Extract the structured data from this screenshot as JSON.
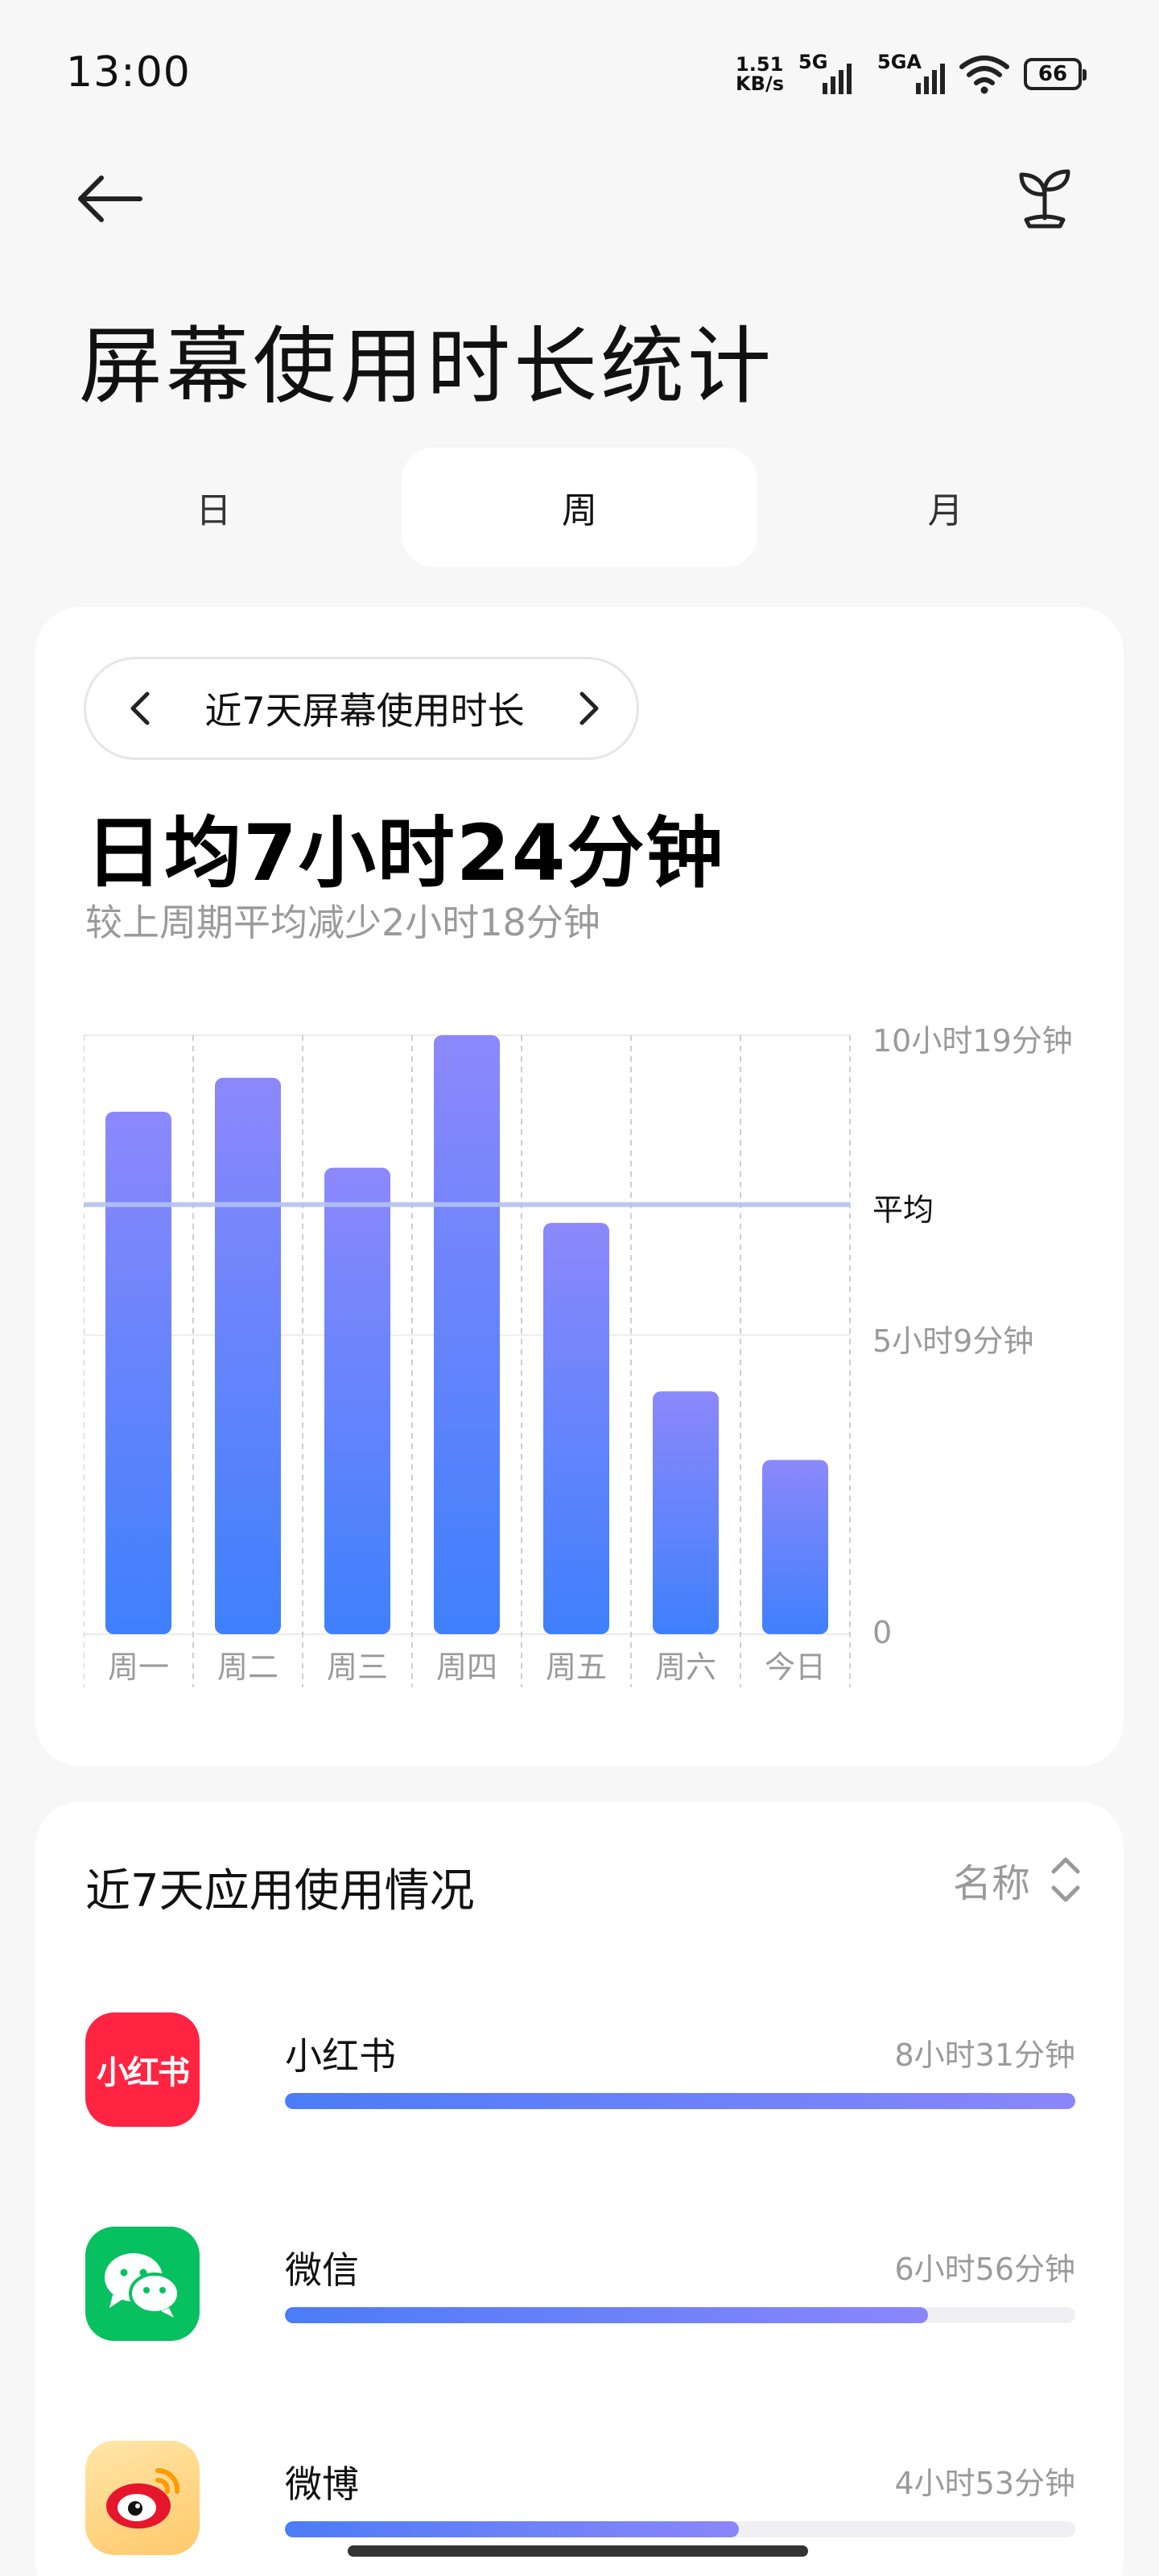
{
  "status": {
    "time": "13:00",
    "speed_value": "1.51",
    "speed_unit": "KB/s",
    "sim1_label": "5G",
    "sim2_label": "5GA",
    "battery": "66"
  },
  "header": {
    "title": "屏幕使用时长统计"
  },
  "tabs": [
    {
      "label": "日",
      "active": false
    },
    {
      "label": "周",
      "active": true
    },
    {
      "label": "月",
      "active": false
    }
  ],
  "summary": {
    "range_label": "近7天屏幕使用时长",
    "average": "日均7小时24分钟",
    "compare": "较上周期平均减少2小时18分钟"
  },
  "chart_data": {
    "type": "bar",
    "categories": [
      "周一",
      "周二",
      "周三",
      "周四",
      "周五",
      "周六",
      "今日"
    ],
    "values": [
      540,
      575,
      482,
      619,
      425,
      251,
      180
    ],
    "value_unit": "minutes",
    "average": 444,
    "average_label": "平均",
    "ylim": [
      0,
      619
    ],
    "y_ticks": [
      {
        "value": 619,
        "label": "10小时19分钟"
      },
      {
        "value": 309,
        "label": "5小时9分钟"
      },
      {
        "value": 0,
        "label": "0"
      }
    ],
    "colors": {
      "bar_top": "#8c88fb",
      "bar_bottom": "#3f80fc",
      "avg_line": "#b3c3ee"
    }
  },
  "apps": {
    "title": "近7天应用使用情况",
    "sort_label": "名称",
    "items": [
      {
        "name": "小红书",
        "time": "8小时31分钟",
        "fraction": 1.0,
        "icon": "xiaohongshu-icon",
        "icon_text": "小红书",
        "color": "#ff2442"
      },
      {
        "name": "微信",
        "time": "6小时56分钟",
        "fraction": 0.814,
        "icon": "wechat-icon",
        "color": "#07c160"
      },
      {
        "name": "微博",
        "time": "4小时53分钟",
        "fraction": 0.574,
        "icon": "weibo-icon",
        "color": "#e6162d"
      }
    ]
  }
}
